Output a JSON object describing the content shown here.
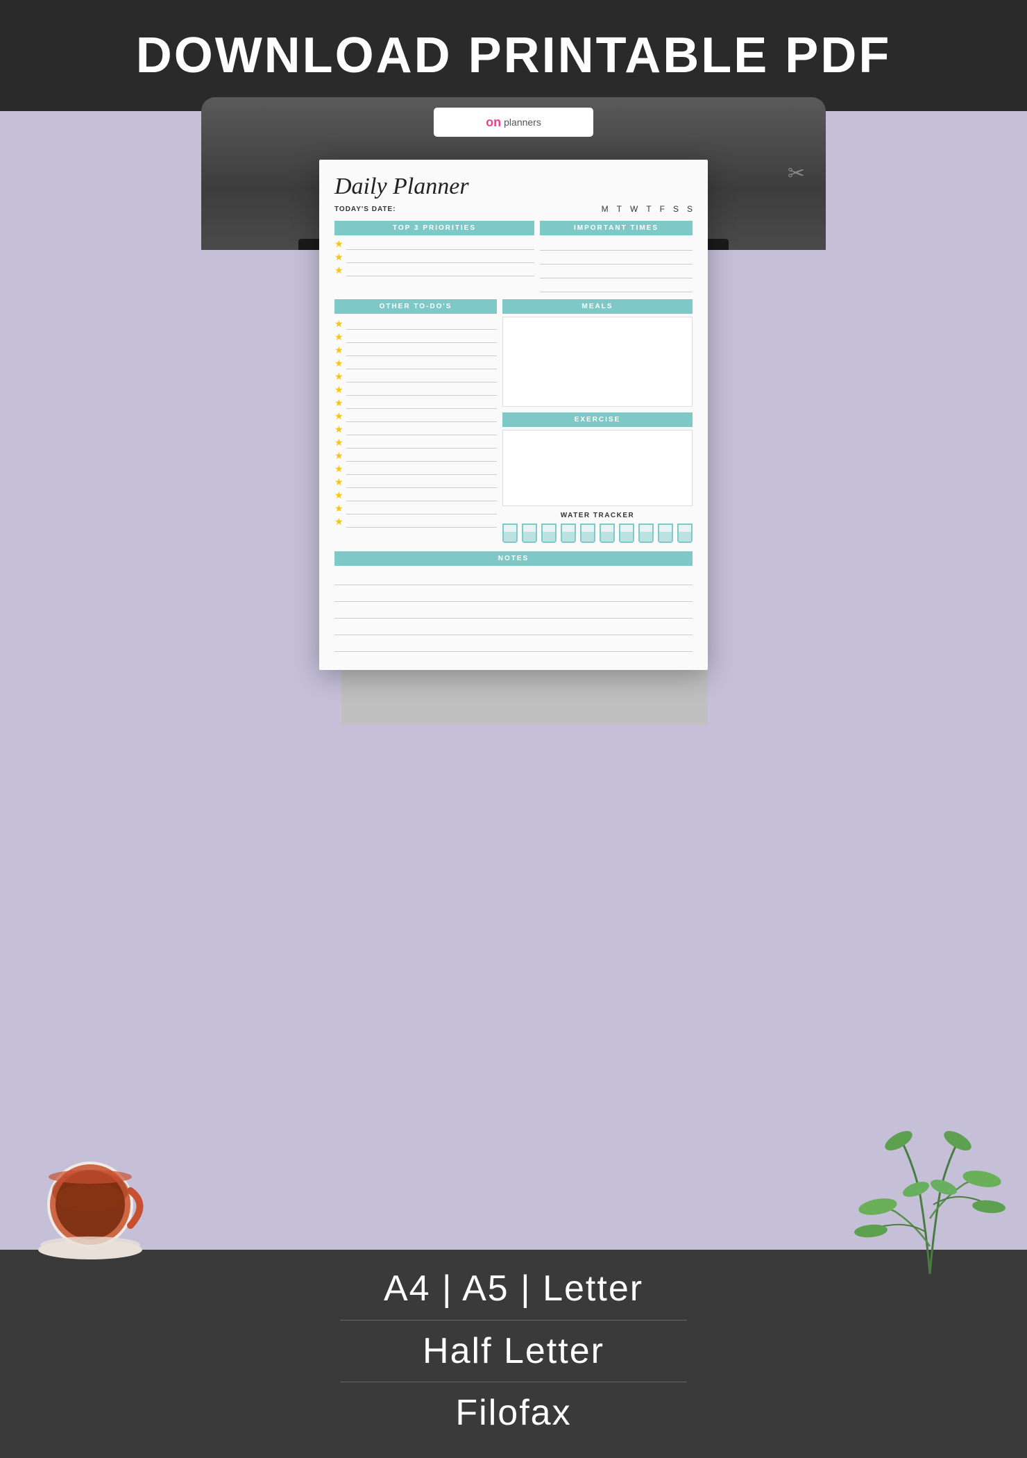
{
  "header": {
    "title": "DOWNLOAD PRINTABLE PDF"
  },
  "brand": {
    "name": "on planners",
    "on_color": "#e84393"
  },
  "planner": {
    "title": "Daily Planner",
    "todays_date_label": "TODAY'S DATE:",
    "days": [
      "M",
      "T",
      "W",
      "T",
      "F",
      "S",
      "S"
    ],
    "sections": {
      "top3_priorities": {
        "header": "TOP 3 PRIORITIES",
        "items_count": 3
      },
      "important_times": {
        "header": "IMPORTANT TIMES",
        "lines_count": 4
      },
      "other_todos": {
        "header": "OTHER TO-DO'S",
        "items_count": 16
      },
      "meals": {
        "header": "MEALS"
      },
      "exercise": {
        "header": "EXERCISE"
      },
      "water_tracker": {
        "label": "WATER TRACKER",
        "glasses_count": 10
      },
      "notes": {
        "header": "NOTES",
        "lines_count": 5
      }
    }
  },
  "formats": [
    "A4 | A5 | Letter",
    "Half Letter",
    "Filofax"
  ],
  "colors": {
    "teal": "#7ec8c8",
    "star_yellow": "#f5c518",
    "background": "#c5c0d8",
    "paper": "#fafafa",
    "dark_bar": "#2a2a2a",
    "bottom_bar": "#3a3a3a"
  }
}
